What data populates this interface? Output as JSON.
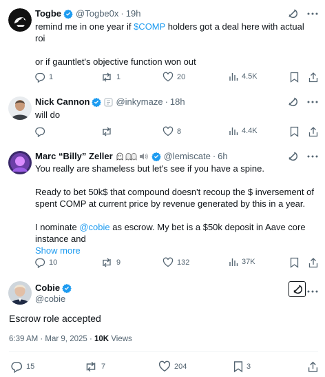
{
  "replies": [
    {
      "name": "Togbe",
      "handle": "@Togbe0x",
      "time": "19h",
      "lines": [
        {
          "parts": [
            "remind me in one year if ",
            "$COMP",
            " holders got a deal here with actual roi"
          ]
        },
        {
          "text": "or if gauntlet's objective function won out"
        }
      ],
      "stats": {
        "replies": "1",
        "reposts": "1",
        "likes": "20",
        "views": "4.5K"
      }
    },
    {
      "name": "Nick Cannon",
      "handle": "@inkymaze",
      "time": "18h",
      "text": "will do",
      "stats": {
        "replies": "",
        "reposts": "",
        "likes": "8",
        "views": "4.4K"
      }
    },
    {
      "name": "Marc “Billy” Zeller",
      "handle": "@lemiscate",
      "time": "6h",
      "p1": "You really are shameless but let's see if you have a spine.",
      "p2": "Ready to bet 50k$ that compound doesn't recoup the $ inversement of spent COMP at current price by revenue generated by this in a year.",
      "p3_pre": "I nominate ",
      "p3_link": "@cobie",
      "p3_post": " as escrow. My bet is a $50k deposit in Aave core instance and",
      "show_more": "Show more",
      "stats": {
        "replies": "10",
        "reposts": "9",
        "likes": "132",
        "views": "37K"
      }
    }
  ],
  "main": {
    "name": "Cobie",
    "handle": "@cobie",
    "text": "Escrow role accepted",
    "timestamp": "6:39 AM · Mar 9, 2025 · ",
    "views_count": "10K",
    "views_label": " Views",
    "stats": {
      "replies": "15",
      "reposts": "7",
      "likes": "204",
      "bookmarks": "3"
    }
  },
  "colors": {
    "accent": "#1d9bf0",
    "muted": "#536471",
    "text": "#0f1419"
  }
}
